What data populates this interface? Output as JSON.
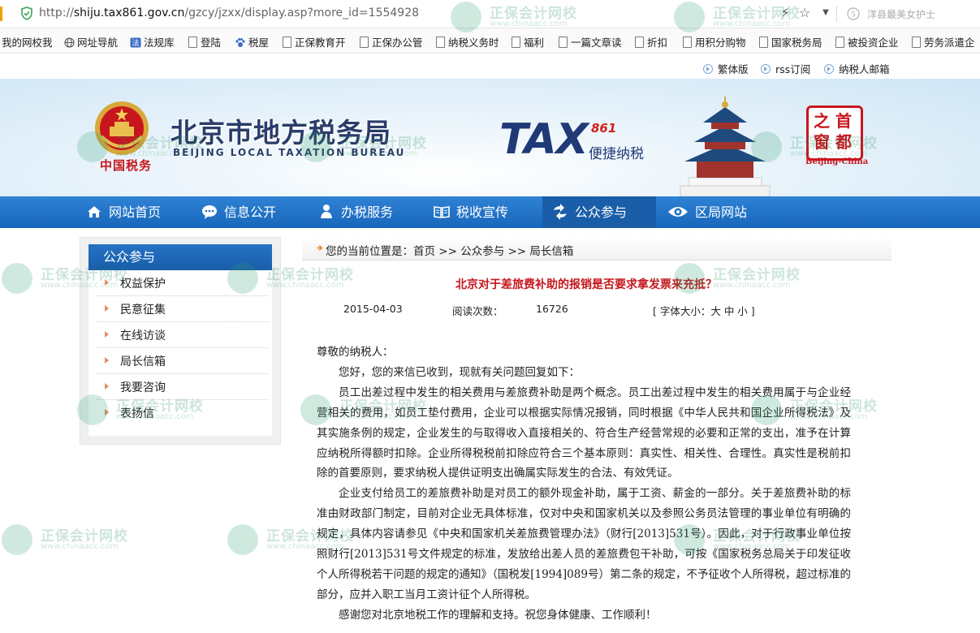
{
  "browser": {
    "url_prefix": "http://",
    "url_domain": "shiju.tax861.gov.cn",
    "url_path": "/gzcy/jzxx/display.asp?more_id=1554928",
    "search_hint": "洋县最美女护士"
  },
  "bookmarks": [
    "我的网校我",
    "网址导航",
    "法规库",
    "登陆",
    "税屋",
    "正保教育开",
    "正保办公管",
    "纳税义务时",
    "福利",
    "一篇文章读",
    "折扣",
    "用积分购物",
    "国家税务局",
    "被投资企业",
    "劳务派遣企"
  ],
  "utility_links": [
    "繁体版",
    "rss订阅",
    "纳税人邮箱"
  ],
  "banner": {
    "title_cn": "北京市地方税务局",
    "title_en": "BEIJING LOCAL TAXATION BUREAU",
    "china_tax": "中国税务",
    "tax_logo": "TAX",
    "tax_num": "861",
    "tax_sub": "便捷纳税",
    "seal_chars": [
      "之",
      "首",
      "窗",
      "都"
    ],
    "seal_caption": "Beijing-China"
  },
  "nav": [
    {
      "label": "网站首页",
      "icon": "home-icon"
    },
    {
      "label": "信息公开",
      "icon": "chat-icon"
    },
    {
      "label": "办税服务",
      "icon": "person-icon"
    },
    {
      "label": "税收宣传",
      "icon": "book-icon"
    },
    {
      "label": "公众参与",
      "icon": "exchange-icon",
      "active": true
    },
    {
      "label": "区局网站",
      "icon": "eye-icon"
    }
  ],
  "sidebar": {
    "title": "公众参与",
    "items": [
      "权益保护",
      "民意征集",
      "在线访谈",
      "局长信箱",
      "我要咨询",
      "表扬信"
    ]
  },
  "breadcrumb": "您的当前位置是：首页  >>  公众参与  >>  局长信箱",
  "article": {
    "title": "北京对于差旅费补助的报销是否要求拿发票来充抵？",
    "date": "2015-04-03",
    "reads_label": "阅读次数：",
    "reads": "16726",
    "font_size": "[ 字体大小：大  中  小 ]",
    "paragraphs": [
      "尊敬的纳税人：",
      "您好，您的来信已收到，现就有关问题回复如下：",
      "员工出差过程中发生的相关费用与差旅费补助是两个概念。员工出差过程中发生的相关费用属于与企业经营相关的费用，如员工垫付费用，企业可以根据实际情况报销，同时根据《中华人民共和国企业所得税法》及其实施条例的规定，企业发生的与取得收入直接相关的、符合生产经营常规的必要和正常的支出，准予在计算应纳税所得额时扣除。企业所得税税前扣除应符合三个基本原则：真实性、相关性、合理性。真实性是税前扣除的首要原则，要求纳税人提供证明支出确属实际发生的合法、有效凭证。",
      "企业支付给员工的差旅费补助是对员工的额外现金补助，属于工资、薪金的一部分。关于差旅费补助的标准由财政部门制定，目前对企业无具体标准，仅对中央和国家机关以及参照公务员法管理的事业单位有明确的规定，具体内容请参见《中央和国家机关差旅费管理办法》（财行[2013]531号）。因此，对于行政事业单位按照财行[2013]531号文件规定的标准，发放给出差人员的差旅费包干补助，可按《国家税务总局关于印发征收个人所得税若干问题的规定的通知》（国税发[1994]089号）第二条的规定，不予征收个人所得税，超过标准的部分，应并入职工当月工资计征个人所得税。",
      "感谢您对北京地税工作的理解和支持。祝您身体健康、工作顺利！"
    ]
  },
  "watermark": {
    "title": "正保会计网校",
    "url": "www.chinaacc.com"
  }
}
